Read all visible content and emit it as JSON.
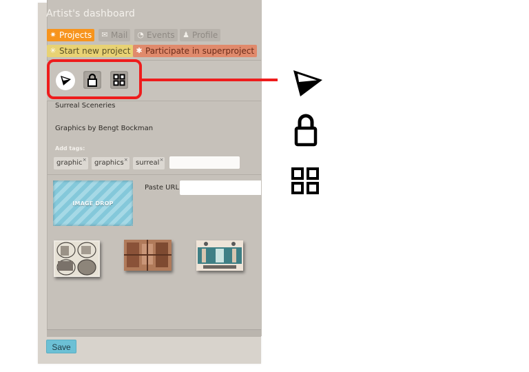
{
  "header": {
    "title": "Artist's dashboard"
  },
  "tabs": [
    {
      "label": "Projects",
      "icon": "sparkle-icon",
      "active": true
    },
    {
      "label": "Mail",
      "icon": "envelope-icon",
      "active": false
    },
    {
      "label": "Events",
      "icon": "clock-icon",
      "active": false
    },
    {
      "label": "Profile",
      "icon": "person-icon",
      "active": false
    }
  ],
  "actions": [
    {
      "label": "Start new project",
      "icon": "asterisk-icon",
      "color": "#e8d274"
    },
    {
      "label": "Participate in superproject",
      "icon": "asterisk-icon",
      "color": "#e08a6c"
    }
  ],
  "toolbar": {
    "buttons": [
      {
        "name": "pointer",
        "icon": "pointer-icon"
      },
      {
        "name": "lock",
        "icon": "lock-icon"
      },
      {
        "name": "grid",
        "icon": "grid-icon"
      }
    ],
    "highlight_color": "#ee1c1c"
  },
  "callout": {
    "icons": [
      "pointer-icon",
      "lock-icon",
      "grid-icon"
    ]
  },
  "project": {
    "title": "Surreal Sceneries",
    "description": "Graphics by Bengt Bockman",
    "tags_label": "Add tags:",
    "tags": [
      "graphic",
      "graphics",
      "surreal"
    ],
    "tag_remove_glyph": "×",
    "tag_input_value": ""
  },
  "media": {
    "image_drop_label": "IMAGE DROP",
    "paste_url_label": "Paste URL",
    "paste_url_value": "",
    "thumbnails": [
      {
        "name": "thumbnail-1",
        "tone": "engraving"
      },
      {
        "name": "thumbnail-2",
        "tone": "sepia"
      },
      {
        "name": "thumbnail-3",
        "tone": "teal"
      }
    ]
  },
  "footer": {
    "save_label": "Save"
  }
}
